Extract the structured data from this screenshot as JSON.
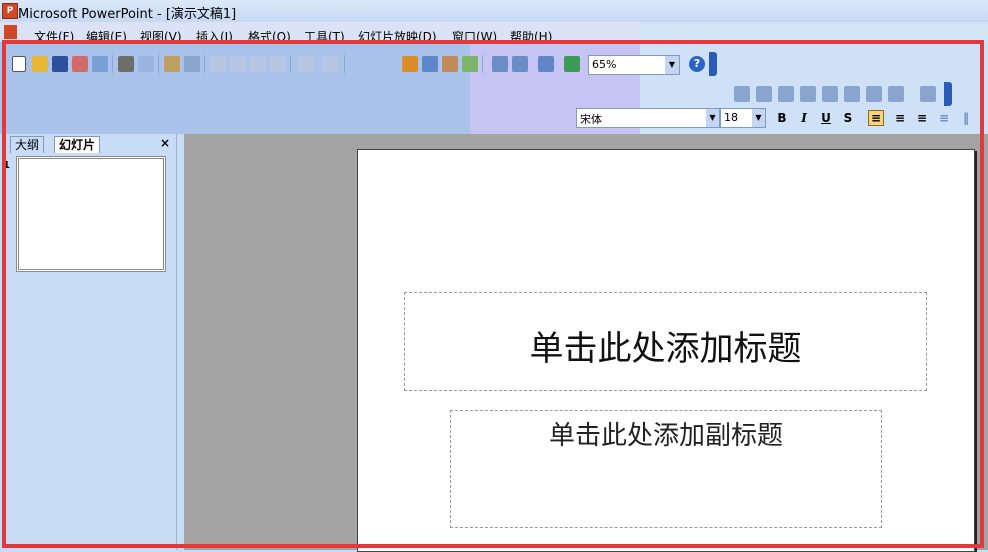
{
  "window": {
    "title": "Microsoft PowerPoint - [演示文稿1]"
  },
  "menu": [
    {
      "label": "文件(F)"
    },
    {
      "label": "编辑(E)"
    },
    {
      "label": "视图(V)"
    },
    {
      "label": "插入(I)"
    },
    {
      "label": "格式(O)"
    },
    {
      "label": "工具(T)"
    },
    {
      "label": "幻灯片放映(D)"
    },
    {
      "label": "窗口(W)"
    },
    {
      "label": "帮助(H)"
    }
  ],
  "toolbar": {
    "zoom": "65%"
  },
  "format_toolbar": {
    "font": "宋体",
    "size": "18",
    "bold": "B",
    "italic": "I",
    "underline": "U",
    "shadow": "S"
  },
  "pane": {
    "tabs": [
      {
        "label": "大纲"
      },
      {
        "label": "幻灯片"
      }
    ],
    "close": "×",
    "slide_number": "1"
  },
  "slide": {
    "title_placeholder": "单击此处添加标题",
    "subtitle_placeholder": "单击此处添加副标题"
  },
  "colors": {
    "highlight": "#e23a3a",
    "toolbar": "#a9c3ea"
  }
}
